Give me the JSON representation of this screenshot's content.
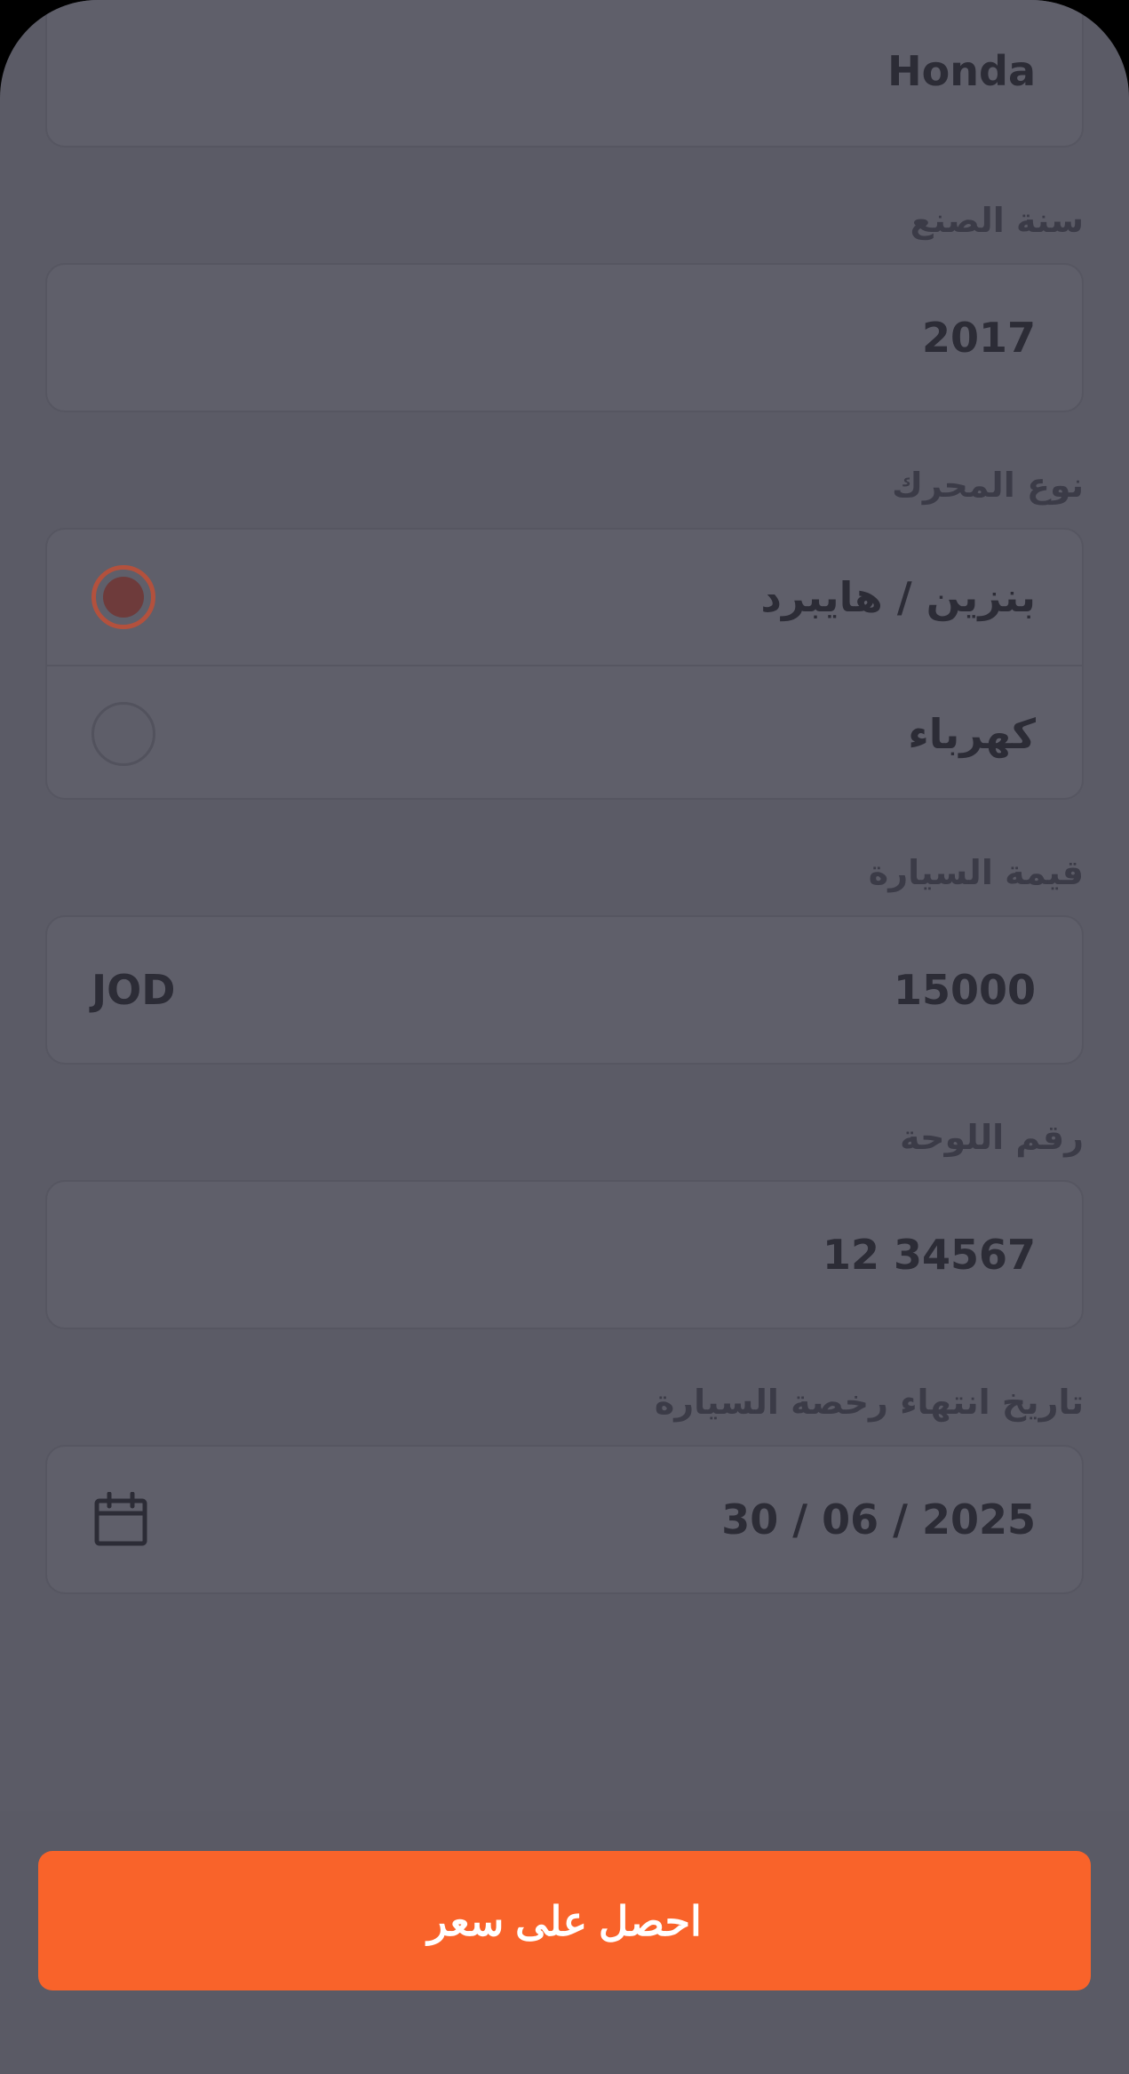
{
  "form": {
    "make": {
      "value": "Honda"
    },
    "year": {
      "label": "سنة الصنع",
      "value": "2017"
    },
    "engine": {
      "label": "نوع المحرك",
      "options": [
        {
          "label": "بنزين / هايبرد",
          "selected": true
        },
        {
          "label": "كهرباء",
          "selected": false
        }
      ]
    },
    "car_value": {
      "label": "قيمة السيارة",
      "value": "15000",
      "currency": "JOD"
    },
    "plate": {
      "label": "رقم اللوحة",
      "value": "12 34567"
    },
    "license_expiry": {
      "label": "تاريخ انتهاء رخصة السيارة",
      "value": "30 / 06 / 2025",
      "icon": "calendar-icon"
    }
  },
  "cta": {
    "label": "احصل على سعر"
  },
  "colors": {
    "accent": "#f9632a",
    "radio_selected": "#b3513d",
    "background": "#5b5b66"
  }
}
